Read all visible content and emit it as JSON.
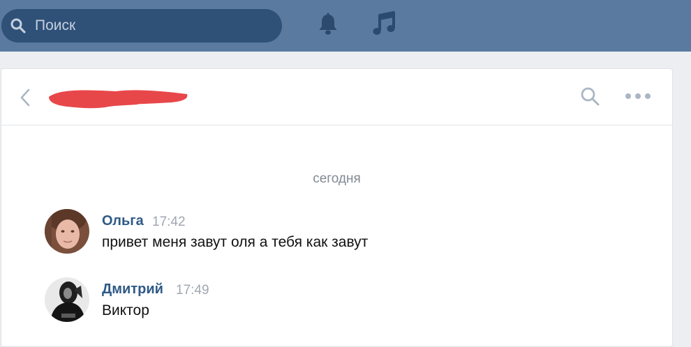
{
  "topbar": {
    "search_placeholder": "Поиск",
    "icons": [
      "search-icon",
      "bell-icon",
      "music-icon"
    ],
    "color": "#5a7aa0"
  },
  "chat": {
    "header_icons": [
      "back-icon",
      "search-icon",
      "more-icon"
    ],
    "date_separator": "сегодня",
    "messages": [
      {
        "author": "Ольга",
        "time": "17:42",
        "text": "привет меня завут оля а тебя как завут"
      },
      {
        "author": "Дмитрий",
        "time": "17:49",
        "text": "Виктор"
      }
    ]
  },
  "colors": {
    "name_link": "#2f5a86",
    "redaction": "#e8474a"
  }
}
